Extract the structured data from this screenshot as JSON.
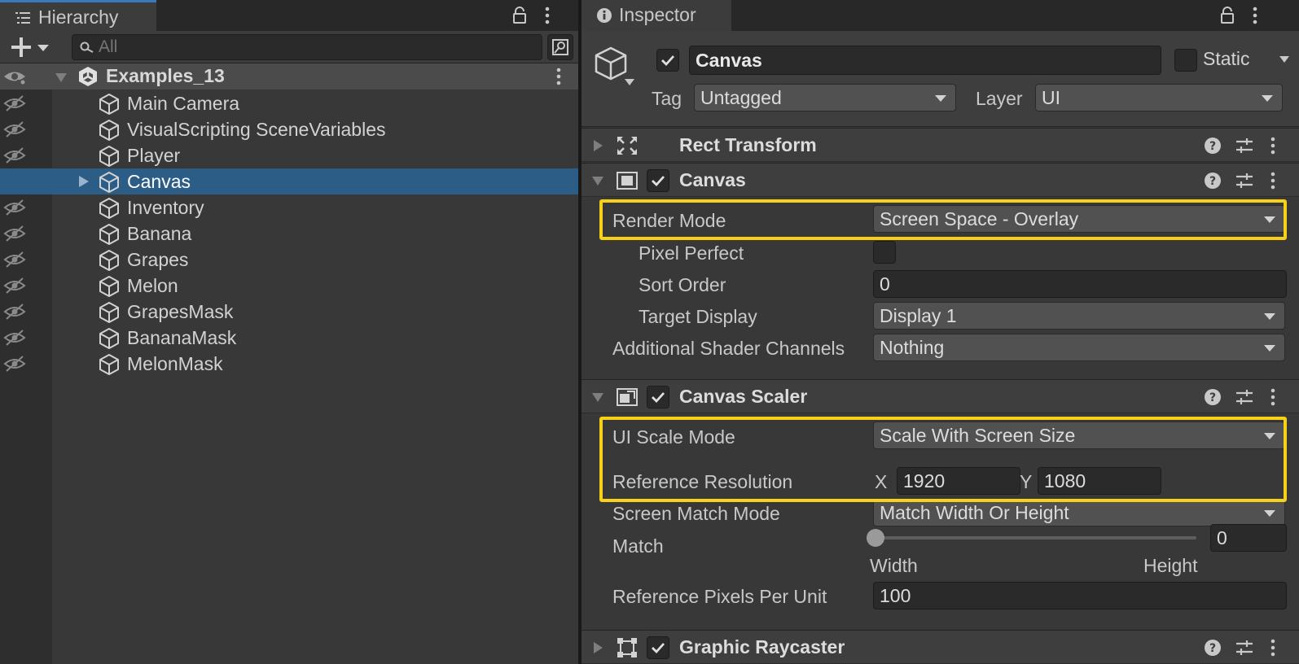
{
  "hierarchy": {
    "tab_title": "Hierarchy",
    "search_placeholder": "All",
    "scene_name": "Examples_13",
    "items": [
      {
        "label": "Main Camera"
      },
      {
        "label": "VisualScripting SceneVariables"
      },
      {
        "label": "Player"
      },
      {
        "label": "Canvas"
      },
      {
        "label": "Inventory"
      },
      {
        "label": "Banana"
      },
      {
        "label": "Grapes"
      },
      {
        "label": "Melon"
      },
      {
        "label": "GrapesMask"
      },
      {
        "label": "BananaMask"
      },
      {
        "label": "MelonMask"
      }
    ],
    "selected_item": "Canvas"
  },
  "inspector": {
    "tab_title": "Inspector",
    "object": {
      "name": "Canvas",
      "static_label": "Static",
      "tag_label": "Tag",
      "tag_value": "Untagged",
      "layer_label": "Layer",
      "layer_value": "UI"
    },
    "rect_transform": {
      "title": "Rect Transform"
    },
    "canvas": {
      "title": "Canvas",
      "render_mode_label": "Render Mode",
      "render_mode_value": "Screen Space - Overlay",
      "pixel_perfect_label": "Pixel Perfect",
      "sort_order_label": "Sort Order",
      "sort_order_value": "0",
      "target_display_label": "Target Display",
      "target_display_value": "Display 1",
      "shader_channels_label": "Additional Shader Channels",
      "shader_channels_value": "Nothing"
    },
    "canvas_scaler": {
      "title": "Canvas Scaler",
      "scale_mode_label": "UI Scale Mode",
      "scale_mode_value": "Scale With Screen Size",
      "ref_res_label": "Reference Resolution",
      "x_label": "X",
      "x_value": "1920",
      "y_label": "Y",
      "y_value": "1080",
      "match_mode_label": "Screen Match Mode",
      "match_mode_value": "Match Width Or Height",
      "match_label": "Match",
      "match_value": "0",
      "match_fraction": 0,
      "width_label": "Width",
      "height_label": "Height",
      "ppu_label": "Reference Pixels Per Unit",
      "ppu_value": "100"
    },
    "graphic_raycaster": {
      "title": "Graphic Raycaster"
    }
  },
  "colors": {
    "selection": "#2c5d87",
    "highlight": "#f7d117",
    "panel": "#383838"
  }
}
